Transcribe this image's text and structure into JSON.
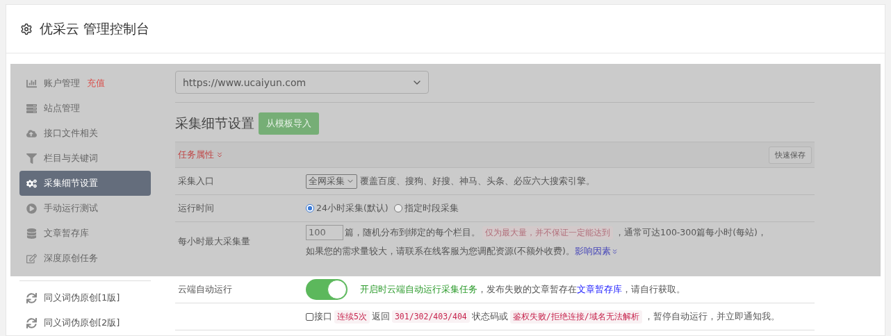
{
  "header": {
    "title": "优采云 管理控制台"
  },
  "sidebar": {
    "items": [
      {
        "label": "账户管理",
        "badge": "充值",
        "selected": false
      },
      {
        "label": "站点管理",
        "selected": false
      },
      {
        "label": "接口文件相关",
        "selected": false
      },
      {
        "label": "栏目与关键词",
        "selected": false
      },
      {
        "label": "采集细节设置",
        "selected": true
      },
      {
        "label": "手动运行测试",
        "selected": false
      },
      {
        "label": "文章暂存库",
        "selected": false
      },
      {
        "label": "深度原创任务",
        "selected": false
      }
    ],
    "tools": [
      {
        "label": "同义词伪原创[1版]",
        "selected": false
      },
      {
        "label": "同义词伪原创[2版]",
        "selected": false
      }
    ]
  },
  "site_select": {
    "value": "https://www.ucaiyun.com"
  },
  "heading": {
    "title": "采集细节设置",
    "button": "从模板导入"
  },
  "section": {
    "title": "任务属性",
    "button": "快速保存"
  },
  "rows": [
    {
      "kind": "select",
      "label": "采集入口",
      "value": "全网采集",
      "parts": [
        {
          "kind": "text",
          "text": "覆盖百度、搜狗、好搜、神马、头条、必应六大搜索引擎。"
        }
      ]
    },
    {
      "kind": "radio",
      "label": "运行时间",
      "options": [
        {
          "label": "24小时采集(默认)",
          "selected": true
        },
        {
          "label": "指定时段采集",
          "selected": false
        }
      ]
    },
    {
      "kind": "number",
      "label": "每小时最大采集量",
      "value": "100",
      "parts": [
        {
          "kind": "text",
          "text": "篇，随机分布到绑定的每个栏目。"
        },
        {
          "kind": "tag",
          "text": "仅为最大量，并不保证一定能达到"
        },
        {
          "kind": "text",
          "text": "，通常可达100-300篇每小时(每站)，"
        }
      ],
      "parts2": [
        {
          "kind": "text",
          "text": "如果您的需求量较大，请联系在线客服为您调配资源(不额外收费)。"
        },
        {
          "kind": "link",
          "text": "影响因素"
        }
      ]
    },
    {
      "kind": "toggle",
      "label": "云端自动运行",
      "on": true,
      "parts": [
        {
          "kind": "note",
          "text": "开启时云端自动运行采集任务"
        },
        {
          "kind": "text",
          "text": "，发布失败的文章暂存在"
        },
        {
          "kind": "link",
          "text": "文章暂存库"
        },
        {
          "kind": "text",
          "text": "，请自行获取。"
        }
      ]
    },
    {
      "kind": "checkbox",
      "checked": false,
      "parts": [
        {
          "kind": "text",
          "text": "接口"
        },
        {
          "kind": "tag",
          "text": "连续5次"
        },
        {
          "kind": "text",
          "text": "返回"
        },
        {
          "kind": "tag",
          "text": "301/302/403/404"
        },
        {
          "kind": "text",
          "text": "状态码或"
        },
        {
          "kind": "tag",
          "text": "鉴权失败/拒绝连接/域名无法解析"
        },
        {
          "kind": "text",
          "text": "，暂停自动运行，并立即通知我。"
        }
      ]
    }
  ]
}
